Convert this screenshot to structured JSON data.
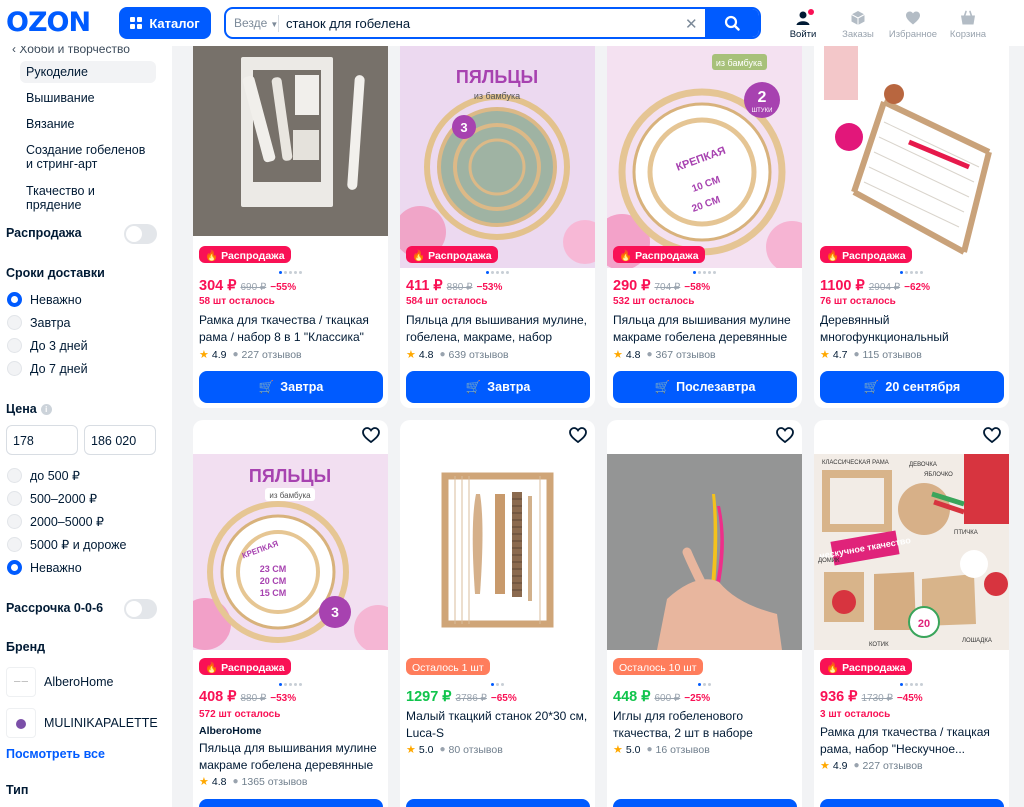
{
  "header": {
    "logo": "OZON",
    "catalog_label": "Каталог",
    "search": {
      "scope": "Везде",
      "query": "станок для гобелена"
    },
    "nav": [
      {
        "label": "Войти",
        "icon": "user-icon"
      },
      {
        "label": "Заказы",
        "icon": "box-icon"
      },
      {
        "label": "Избранное",
        "icon": "heart-icon"
      },
      {
        "label": "Корзина",
        "icon": "cart-icon"
      }
    ]
  },
  "sidebar": {
    "breadcrumb": "Хобби и творчество",
    "categories": [
      {
        "label": "Рукоделие",
        "selected": true
      },
      {
        "label": "Вышивание"
      },
      {
        "label": "Вязание"
      },
      {
        "label": "Создание гобеленов и стринг-арт"
      },
      {
        "label": "Ткачество и прядение"
      }
    ],
    "sale_label": "Распродажа",
    "delivery": {
      "title": "Сроки доставки",
      "options": [
        "Неважно",
        "Завтра",
        "До 3 дней",
        "До 7 дней"
      ],
      "selected": "Неважно"
    },
    "price": {
      "title": "Цена",
      "from": "178",
      "to": "186 020",
      "options": [
        "до 500 ₽",
        "500–2000 ₽",
        "2000–5000 ₽",
        "5000 ₽ и дороже",
        "Неважно"
      ],
      "selected": "Неважно"
    },
    "installment_label": "Рассрочка 0-0-6",
    "brand": {
      "title": "Бренд",
      "items": [
        "AlberoHome",
        "MULINIKAPALETTE"
      ],
      "see_all": "Посмотреть все"
    },
    "type_title": "Тип"
  },
  "products": [
    {
      "badge": "Распродажа",
      "badge_type": "sale",
      "price": "304 ₽",
      "old_price": "690 ₽",
      "discount": "−55%",
      "stock": "58 шт осталось",
      "title": "Рамка для ткачества / ткацкая рама / набор 8 в 1 \"Классика\"",
      "rating": "4.9",
      "reviews": "227 отзывов",
      "delivery": "Завтра"
    },
    {
      "badge": "Распродажа",
      "badge_type": "sale",
      "price": "411 ₽",
      "old_price": "880 ₽",
      "discount": "−53%",
      "stock": "584 шт осталось",
      "title": "Пяльца для вышивания мулине, гобелена, макраме, набор коле...",
      "rating": "4.8",
      "reviews": "639 отзывов",
      "delivery": "Завтра"
    },
    {
      "badge": "Распродажа",
      "badge_type": "sale",
      "price": "290 ₽",
      "old_price": "704 ₽",
      "discount": "−58%",
      "stock": "532 шт осталось",
      "title": "Пяльца для вышивания мулине макраме гобелена деревянные ...",
      "rating": "4.8",
      "reviews": "367 отзывов",
      "delivery": "Послезавтра"
    },
    {
      "badge": "Распродажа",
      "badge_type": "sale",
      "price": "1100 ₽",
      "old_price": "2904 ₽",
      "discount": "−62%",
      "stock": "76 шт осталось",
      "title": "Деревянный многофункциональный ткацкий...",
      "rating": "4.7",
      "reviews": "115 отзывов",
      "delivery": "20 сентября"
    },
    {
      "badge": "Распродажа",
      "badge_type": "sale",
      "price": "408 ₽",
      "old_price": "880 ₽",
      "discount": "−53%",
      "stock": "572 шт осталось",
      "seller": "AlberoHome",
      "title": "Пяльца для вышивания мулине макраме гобелена деревянные ...",
      "rating": "4.8",
      "reviews": "1365 отзывов",
      "thumb_text": "ПЯЛЬЦЫ"
    },
    {
      "badge": "Осталось 1 шт",
      "badge_type": "left",
      "price": "1297 ₽",
      "old_price": "3786 ₽",
      "discount": "−65%",
      "price_green": true,
      "title": "Малый ткацкий станок 20*30 см, Luca-S",
      "rating": "5.0",
      "reviews": "80 отзывов"
    },
    {
      "badge": "Осталось 10 шт",
      "badge_type": "left",
      "price": "448 ₽",
      "old_price": "600 ₽",
      "discount": "−25%",
      "price_green": true,
      "title": "Иглы для гобеленового ткачества, 2 шт в наборе",
      "rating": "5.0",
      "reviews": "16 отзывов"
    },
    {
      "badge": "Распродажа",
      "badge_type": "sale",
      "price": "936 ₽",
      "old_price": "1730 ₽",
      "discount": "−45%",
      "stock": "3 шт осталось",
      "title": "Рамка для ткачества / ткацкая рама, набор \"Нескучное...",
      "rating": "4.9",
      "reviews": "227 отзывов"
    }
  ],
  "thumb_text": {
    "hoops_title": "ПЯЛЬЦЫ",
    "hoops_sub": "из бамбука",
    "bamboo": "из бамбука",
    "pieces_3": "3",
    "pieces_2": "2",
    "pieces_word": "ШТУКИ",
    "strong": "КРЕПКАЯ",
    "cm23": "23 СМ",
    "cm20": "20 СМ",
    "cm15": "15 СМ",
    "cm10": "10 СМ",
    "classic_frame": "КЛАССИЧЕСКАЯ РАМА",
    "girl": "ДЕВОЧКА",
    "apple": "ЯБЛОЧКО",
    "bird": "ПТИЧКА",
    "house": "ДОМИК",
    "cat": "КОТИК",
    "horse": "ЛОШАДКА",
    "fun_weaving": "нескучное ткачество",
    "pieces_20": "20"
  },
  "colors": {
    "accent": "#005bff",
    "sale": "#f91155",
    "green": "#10c44c",
    "left_badge": "#ff7d5c"
  }
}
